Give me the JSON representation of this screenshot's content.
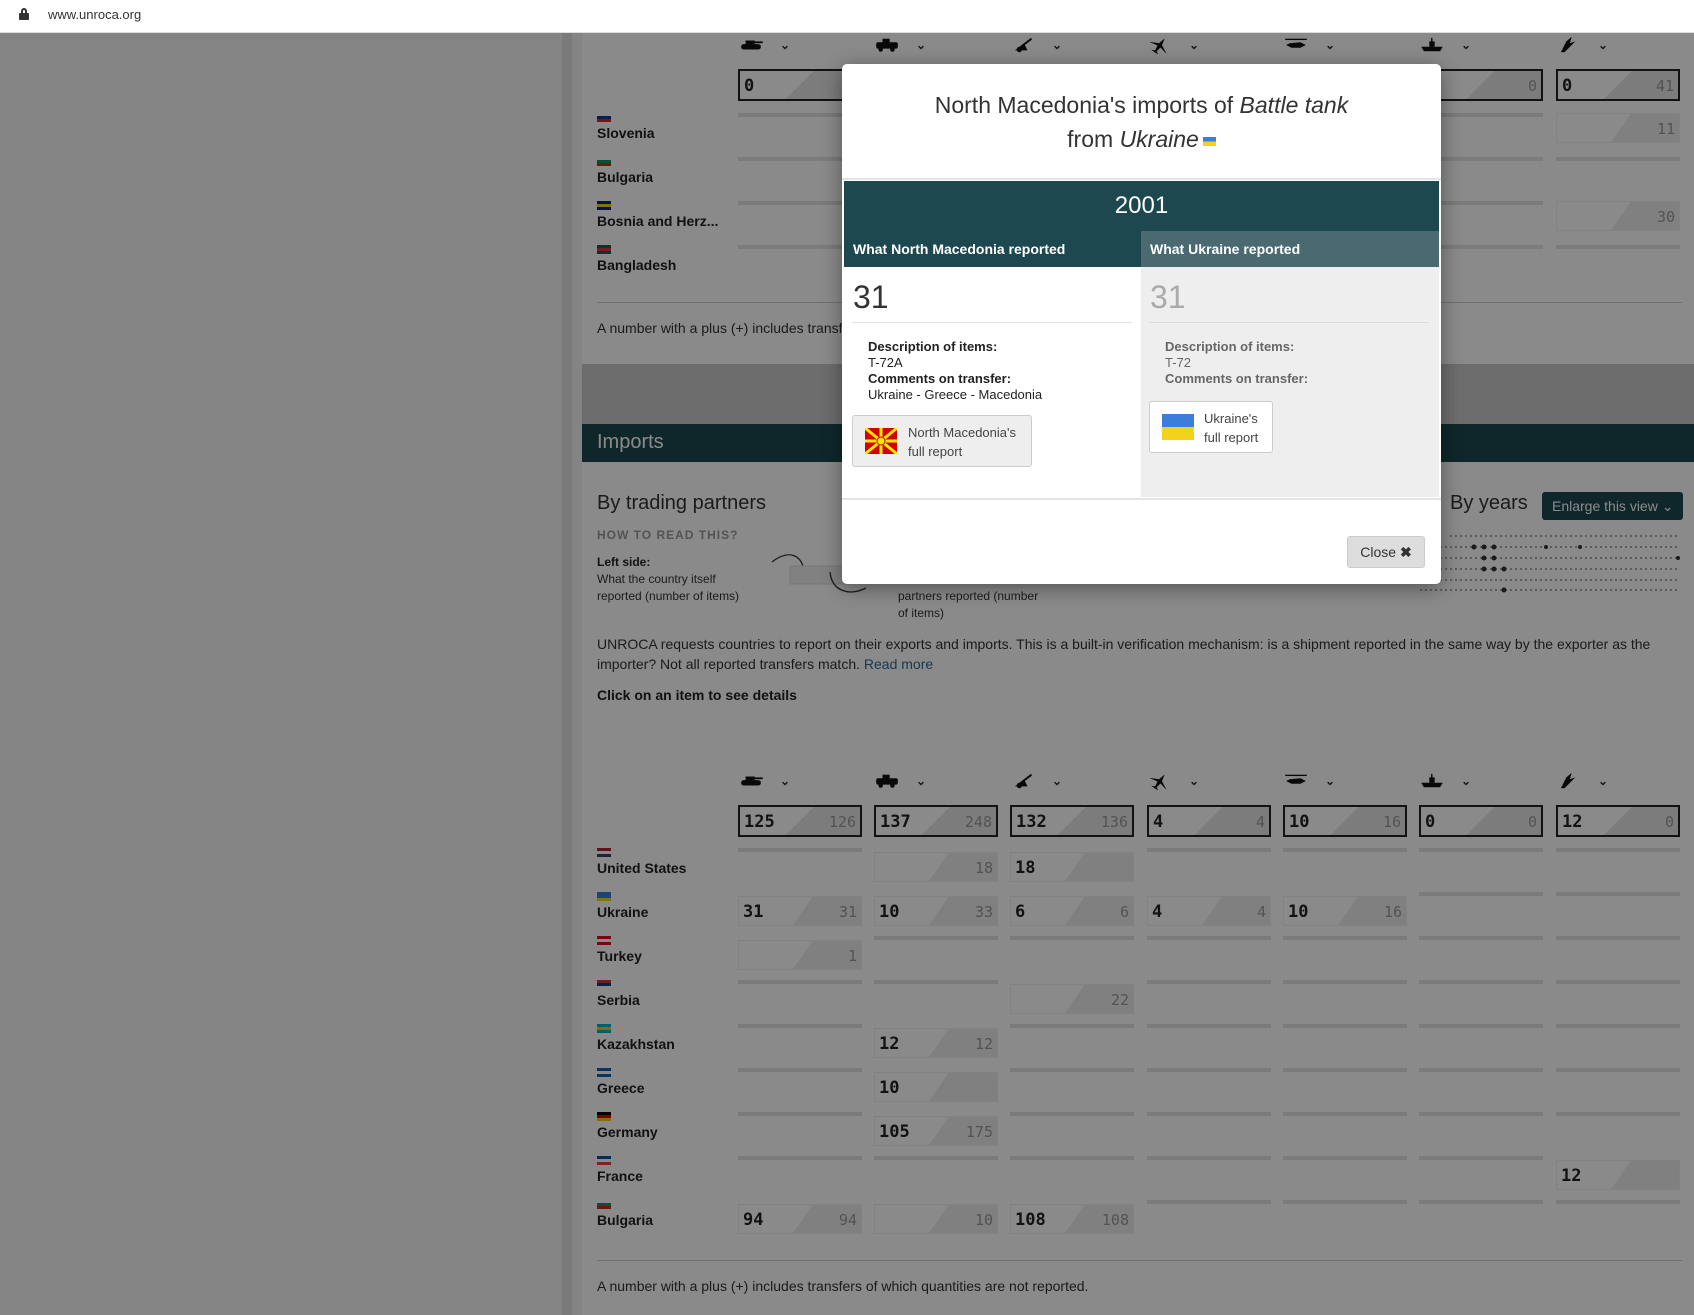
{
  "browser": {
    "url": "www.unroca.org"
  },
  "top_table": {
    "totals": [
      {
        "left": "0",
        "right": ""
      },
      {
        "left": "",
        "right": ""
      },
      {
        "left": "",
        "right": ""
      },
      {
        "left": "",
        "right": ""
      },
      {
        "left": "",
        "right": ""
      },
      {
        "left": "",
        "right": "0"
      },
      {
        "left": "0",
        "right": "41"
      }
    ],
    "countries": [
      {
        "name": "Slovenia",
        "flag": "slovenia-flag"
      },
      {
        "name": "Bulgaria",
        "flag": "bulgaria-flag"
      },
      {
        "name": "Bosnia and Herz...",
        "flag": "bosnia-flag"
      },
      {
        "name": "Bangladesh",
        "flag": "bangladesh-flag"
      }
    ],
    "slovenia_right_value": "11",
    "bosnia_right_value": "30",
    "footnote": "A number with a plus (+) includes transf"
  },
  "imports": {
    "section_title": "Imports",
    "by_trading_partners": "By trading partners",
    "how_to_read": "HOW TO READ THIS?",
    "left_side_label": "Left side:",
    "left_side_text_1": "What the country itself",
    "left_side_text_2": "reported (number of items)",
    "right_side_text_1": "partners reported (number",
    "right_side_text_2": "of items)",
    "by_years": "By years",
    "enlarge_label": "Enlarge this view",
    "paragraph_1": "UNROCA requests countries to report on their exports and imports. This is a built-in verification mechanism: is a shipment reported in the same way by the exporter as the",
    "paragraph_2": "importer? Not all reported transfers match.",
    "read_more": "Read more",
    "click_hint": "Click on an item to see details",
    "categories": [
      "battle-tank",
      "armoured-combat-vehicle",
      "artillery",
      "combat-aircraft",
      "attack-helicopter",
      "warship",
      "missile-launcher"
    ],
    "totals": [
      {
        "left": "125",
        "right": "126"
      },
      {
        "left": "137",
        "right": "248"
      },
      {
        "left": "132",
        "right": "136"
      },
      {
        "left": "4",
        "right": "4"
      },
      {
        "left": "10",
        "right": "16"
      },
      {
        "left": "0",
        "right": "0"
      },
      {
        "left": "12",
        "right": "0"
      }
    ],
    "rows": [
      {
        "name": "United States",
        "flag": "us-flag",
        "cells": [
          null,
          {
            "left": "",
            "right": "18"
          },
          {
            "left": "18",
            "right": ""
          },
          null,
          null,
          null,
          null
        ]
      },
      {
        "name": "Ukraine",
        "flag": "ukraine-flag",
        "cells": [
          {
            "left": "31",
            "right": "31"
          },
          {
            "left": "10",
            "right": "33"
          },
          {
            "left": "6",
            "right": "6"
          },
          {
            "left": "4",
            "right": "4"
          },
          {
            "left": "10",
            "right": "16"
          },
          null,
          null
        ]
      },
      {
        "name": "Turkey",
        "flag": "turkey-flag",
        "cells": [
          {
            "left": "",
            "right": "1"
          },
          null,
          null,
          null,
          null,
          null,
          null
        ]
      },
      {
        "name": "Serbia",
        "flag": "serbia-flag",
        "cells": [
          null,
          null,
          {
            "left": "",
            "right": "22"
          },
          null,
          null,
          null,
          null
        ]
      },
      {
        "name": "Kazakhstan",
        "flag": "kazakhstan-flag",
        "cells": [
          null,
          {
            "left": "12",
            "right": "12"
          },
          null,
          null,
          null,
          null,
          null
        ]
      },
      {
        "name": "Greece",
        "flag": "greece-flag",
        "cells": [
          null,
          {
            "left": "10",
            "right": ""
          },
          null,
          null,
          null,
          null,
          null
        ]
      },
      {
        "name": "Germany",
        "flag": "germany-flag",
        "cells": [
          null,
          {
            "left": "105",
            "right": "175"
          },
          null,
          null,
          null,
          null,
          null
        ]
      },
      {
        "name": "France",
        "flag": "france-flag",
        "cells": [
          null,
          null,
          null,
          null,
          null,
          null,
          {
            "left": "12",
            "right": ""
          }
        ]
      },
      {
        "name": "Bulgaria",
        "flag": "bulgaria-flag",
        "cells": [
          {
            "left": "94",
            "right": "94"
          },
          {
            "left": "",
            "right": "10"
          },
          {
            "left": "108",
            "right": "108"
          },
          null,
          null,
          null,
          null
        ]
      }
    ],
    "footnote": "A number with a plus (+) includes transfers of which quantities are not reported."
  },
  "modal": {
    "title_prefix": "North Macedonia's imports of",
    "title_item": "Battle tank",
    "title_from": "from",
    "title_country": "Ukraine",
    "year": "2001",
    "left_header": "What North Macedonia reported",
    "right_header": "What Ukraine reported",
    "left_value": "31",
    "right_value": "31",
    "desc_label": "Description of items:",
    "comments_label": "Comments on transfer:",
    "left_desc": "T-72A",
    "left_comments": "Ukraine - Greece - Macedonia",
    "right_desc": "T-72",
    "right_comments": "",
    "left_report_1": "North Macedonia's",
    "left_report_2": "full report",
    "right_report_1": "Ukraine's",
    "right_report_2": "full report",
    "close_label": "Close",
    "colors": {
      "header_dark": "#1d4850",
      "header_right": "#4b6970"
    }
  }
}
